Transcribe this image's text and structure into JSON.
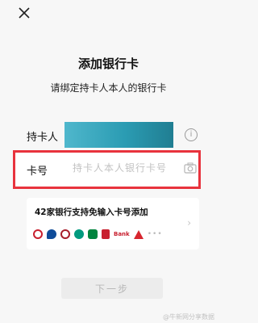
{
  "page": {
    "title": "添加银行卡",
    "subtitle": "请绑定持卡人本人的银行卡"
  },
  "form": {
    "holder_label": "持卡人",
    "card_label": "卡号",
    "card_placeholder": "持卡人本人银行卡号",
    "info_icon": "i"
  },
  "banks": {
    "text": "42家银行支持免输入卡号添加",
    "chevron": "›",
    "logos": [
      "icbc-logo",
      "ccb-logo",
      "boc-logo",
      "abc-logo",
      "psbc-logo",
      "spdb-logo",
      "bank-text-logo",
      "cmb-logo"
    ],
    "text_logo": "Bank",
    "more": "•••"
  },
  "actions": {
    "next_label": "下一步"
  },
  "watermark": "@牛新网分享数据",
  "colors": {
    "highlight": "#e8333d",
    "holder_fill": "#2b9cb3"
  }
}
